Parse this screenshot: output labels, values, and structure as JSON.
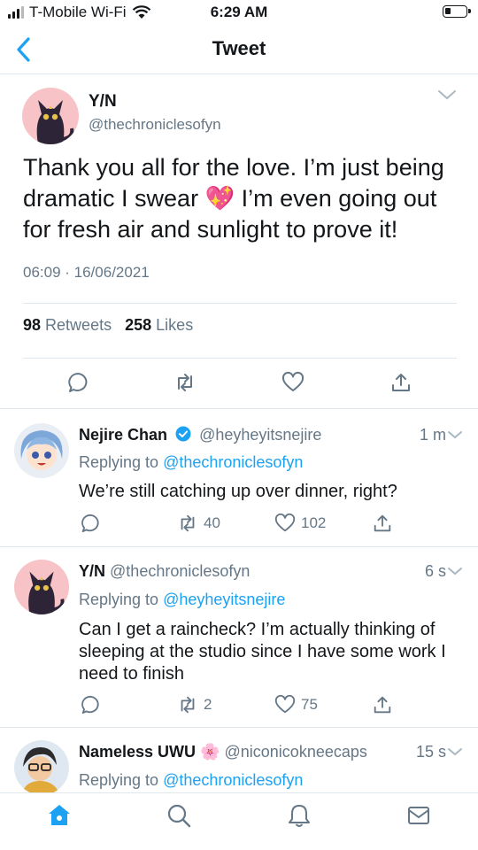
{
  "status_bar": {
    "carrier": "T-Mobile Wi-Fi",
    "time": "6:29 AM"
  },
  "nav": {
    "title": "Tweet"
  },
  "main_tweet": {
    "name": "Y/N",
    "handle": "@thechroniclesofyn",
    "text": "Thank you all for the love. I’m just being dramatic I swear 💖 I’m even going out for fresh air and sunlight to prove it!",
    "datetime": "06:09 · 16/06/2021",
    "retweets_count": "98",
    "retweets_label": "Retweets",
    "likes_count": "258",
    "likes_label": "Likes"
  },
  "replies": [
    {
      "name": "Nejire Chan",
      "verified": true,
      "handle": "@heyheyitsnejire",
      "time": "1 m",
      "replying_prefix": "Replying to",
      "replying_to": "@thechroniclesofyn",
      "text": "We’re still catching up over dinner, right?",
      "retweets": "40",
      "likes": "102"
    },
    {
      "name": "Y/N",
      "handle": "@thechroniclesofyn",
      "time": "6 s",
      "replying_prefix": "Replying to",
      "replying_to": "@heyheyitsnejire",
      "text": "Can I get a raincheck? I’m actually thinking of sleeping at the studio since I have some work I need to finish",
      "retweets": "2",
      "likes": "75"
    },
    {
      "name": "Nameless UWU",
      "name_emoji": "🌸",
      "handle": "@niconicokneecaps",
      "time": "15 s",
      "replying_prefix": "Replying to",
      "replying_to": "@thechroniclesofyn"
    }
  ],
  "icons": {
    "back": "chevron-left-icon",
    "reply": "comment-icon",
    "retweet": "retweet-icon",
    "like": "heart-icon",
    "share": "share-icon",
    "tabs": [
      "home-icon",
      "search-icon",
      "notifications-icon",
      "messages-icon"
    ]
  },
  "colors": {
    "accent": "#1da1f2",
    "secondary_text": "#657786",
    "border": "#e1e8ed"
  }
}
